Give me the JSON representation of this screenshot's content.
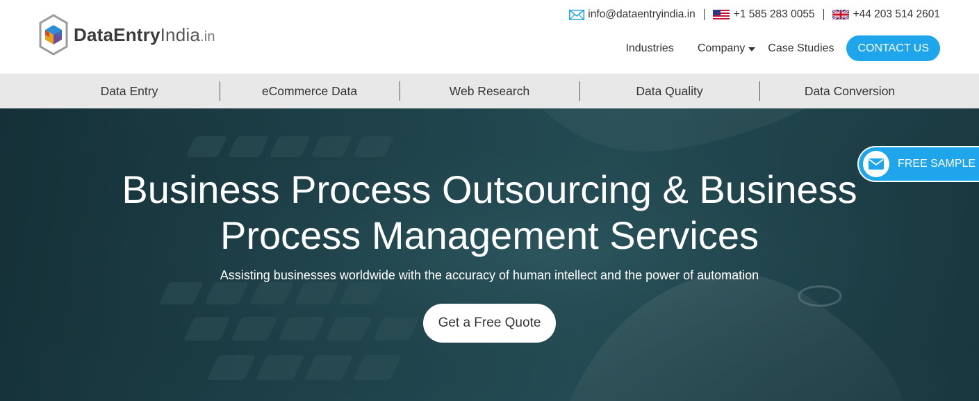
{
  "header": {
    "logo": {
      "part1": "Data",
      "part2": "Entry",
      "part3": "India",
      "part4": ".in"
    },
    "contact": {
      "email": "info@dataentryindia.in",
      "phone_us": "+1 585 283 0055",
      "phone_uk": "+44 203 514 2601"
    },
    "nav": {
      "industries": "Industries",
      "company": "Company",
      "case_studies": "Case Studies",
      "contact_us": "CONTACT US"
    }
  },
  "services": [
    {
      "label": "Data Entry"
    },
    {
      "label": "eCommerce Data"
    },
    {
      "label": "Web Research"
    },
    {
      "label": "Data Quality"
    },
    {
      "label": "Data Conversion"
    }
  ],
  "hero": {
    "title_line1": "Business Process Outsourcing & Business",
    "title_line2": "Process Management Services",
    "subtitle": "Assisting businesses worldwide with the accuracy of human intellect and the power of automation",
    "cta": "Get a Free Quote"
  },
  "free_sample": {
    "label": "FREE SAMPLE"
  },
  "icons": {
    "mail": "mail-icon",
    "us_flag": "us-flag-icon",
    "uk_flag": "uk-flag-icon",
    "dropdown": "chevron-down-icon",
    "envelope": "envelope-icon"
  },
  "colors": {
    "accent": "#1ea5eb",
    "service_bar": "#e8e8e8",
    "hero_overlay": "#244a54"
  }
}
